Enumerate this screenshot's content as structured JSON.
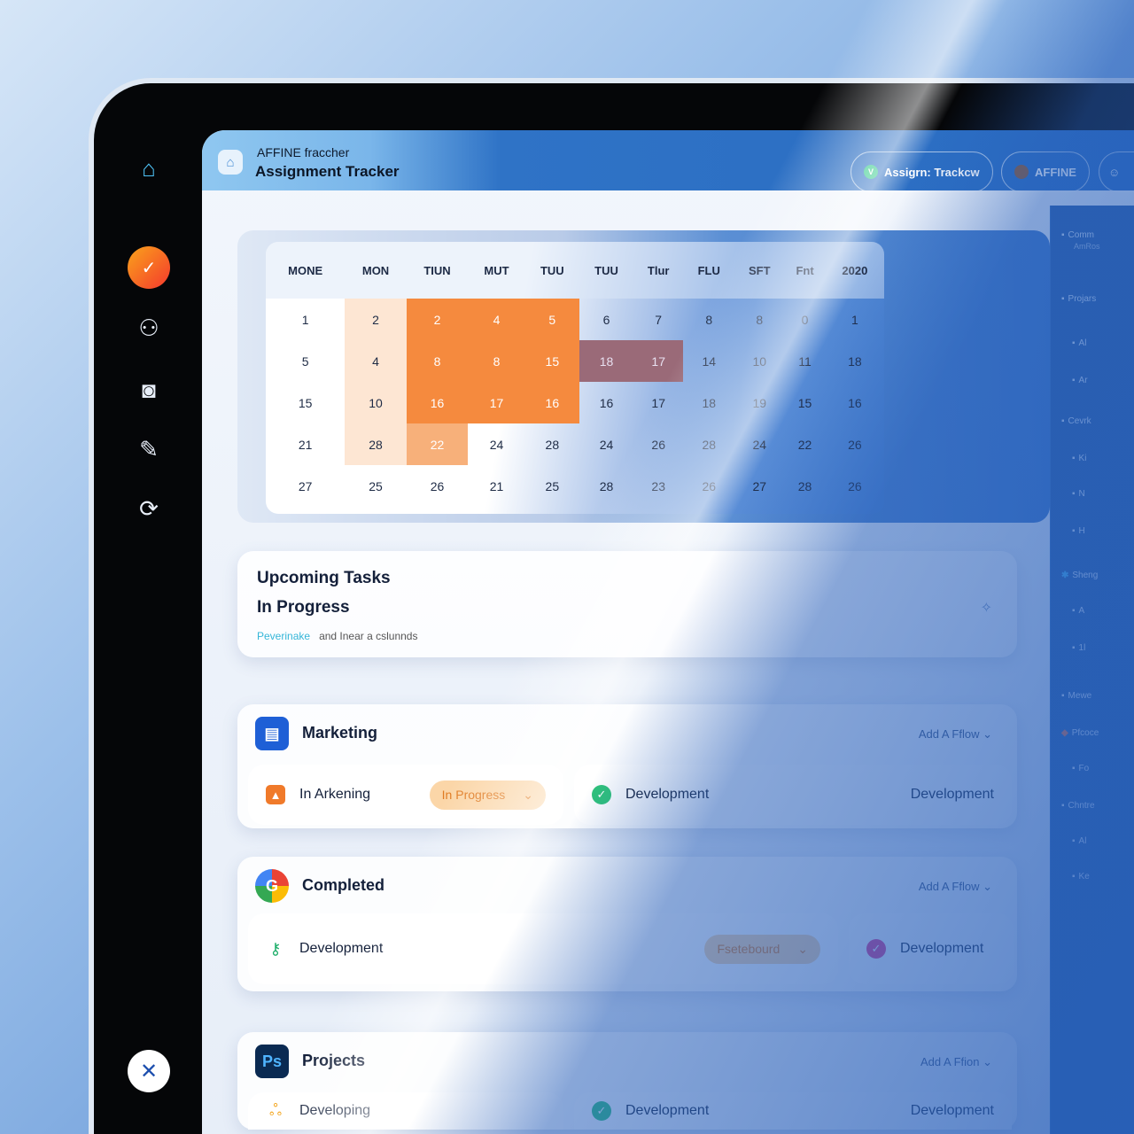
{
  "header": {
    "subtitle": "AFFINE fraccher",
    "title": "Assignment Tracker",
    "pill_label": "Assigrn: Trackcw",
    "user_label": "AFFINE"
  },
  "sidebar": {
    "icons": [
      "home-icon",
      "timer-icon",
      "people-icon",
      "camera-icon",
      "pen-icon",
      "spinner-icon",
      "close-icon"
    ],
    "accent": "#f5592d"
  },
  "right_panel": {
    "items": [
      {
        "label": "Comm",
        "sub": "AmRos"
      },
      {
        "label": "Projars"
      },
      {
        "label": "Al"
      },
      {
        "label": "Ar"
      },
      {
        "label": "Cevrk"
      },
      {
        "label": "Ki"
      },
      {
        "label": "N"
      },
      {
        "label": "H"
      },
      {
        "label": "Sheng"
      },
      {
        "label": "A"
      },
      {
        "label": "1l"
      },
      {
        "label": "Mewe"
      },
      {
        "label": "Pfcoce"
      },
      {
        "label": "Fo"
      },
      {
        "label": "Chntre"
      },
      {
        "label": "Al"
      },
      {
        "label": "Ke"
      }
    ]
  },
  "calendar": {
    "headers": [
      "MONE",
      "MON",
      "TIUN",
      "MUT",
      "TUU",
      "TUU",
      "Tlur",
      "FLU",
      "SFT",
      "Fnt",
      "2020"
    ],
    "rows": [
      [
        "1",
        "2",
        "2",
        "4",
        "5",
        "6",
        "7",
        "8",
        "8",
        "0",
        "1"
      ],
      [
        "5",
        "4",
        "8",
        "8",
        "15",
        "18",
        "17",
        "14",
        "10",
        "11",
        "18"
      ],
      [
        "15",
        "10",
        "16",
        "17",
        "16",
        "16",
        "17",
        "18",
        "19",
        "15",
        "16"
      ],
      [
        "21",
        "28",
        "22",
        "24",
        "28",
        "24",
        "26",
        "28",
        "24",
        "22",
        "26"
      ],
      [
        "27",
        "25",
        "26",
        "21",
        "25",
        "28",
        "23",
        "26",
        "27",
        "28",
        "26"
      ]
    ],
    "heat": [
      [
        0,
        1,
        3,
        3,
        3,
        0,
        0,
        0,
        0,
        0,
        0
      ],
      [
        0,
        1,
        3,
        3,
        3,
        4,
        4,
        0,
        0,
        0,
        0
      ],
      [
        0,
        1,
        3,
        3,
        3,
        0,
        0,
        0,
        0,
        0,
        0
      ],
      [
        0,
        1,
        2,
        0,
        0,
        0,
        0,
        0,
        0,
        0,
        0
      ],
      [
        0,
        0,
        0,
        0,
        0,
        0,
        0,
        0,
        0,
        0,
        0
      ]
    ],
    "colors": {
      "strong": "#f58a3e",
      "light": "#fcdec4"
    }
  },
  "upcoming": {
    "title": "Upcoming Tasks",
    "subtitle": "In Progress",
    "link": "Peverinake",
    "note": "and Inear a cslunnds"
  },
  "sections": [
    {
      "title": "Marketing",
      "icon": "docs-icon",
      "add": "Add A Fflow",
      "left": {
        "label": "In Arkening",
        "badge": "In Progress"
      },
      "mid": "Development",
      "right": "Development"
    },
    {
      "title": "Completed",
      "icon": "google-icon",
      "add": "Add A Fflow",
      "left": {
        "label": "Development",
        "badge": "Fsetebourd"
      },
      "right": "Development"
    },
    {
      "title": "Projects",
      "icon": "photoshop-icon",
      "icon_text": "Ps",
      "add": "Add A Ffion",
      "left": {
        "label": "Developing"
      },
      "mid": "Development",
      "right": "Development"
    }
  ]
}
